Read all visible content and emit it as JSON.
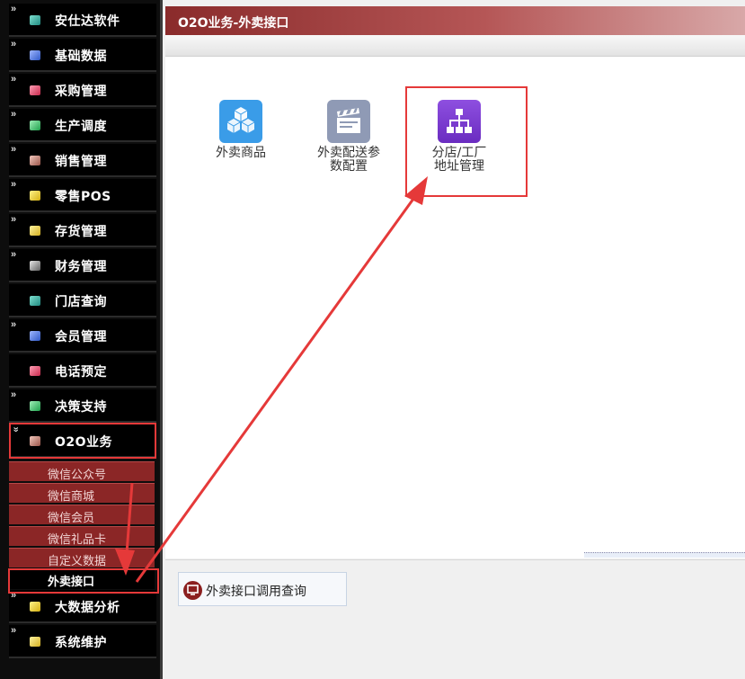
{
  "sidebar": {
    "items": [
      {
        "label": "安仕达软件",
        "icon": "module-icon",
        "color": "#3aa89a"
      },
      {
        "label": "基础数据",
        "icon": "module-icon",
        "color": "#4b77e0"
      },
      {
        "label": "采购管理",
        "icon": "module-icon",
        "color": "#e0486a"
      },
      {
        "label": "生产调度",
        "icon": "module-icon",
        "color": "#3dc56b"
      },
      {
        "label": "销售管理",
        "icon": "module-icon",
        "color": "#c98478"
      },
      {
        "label": "零售POS",
        "icon": "module-icon",
        "color": "#f0d230"
      },
      {
        "label": "存货管理",
        "icon": "module-icon",
        "color": "#f0d53a"
      },
      {
        "label": "财务管理",
        "icon": "module-icon",
        "color": "#9a9a9a"
      },
      {
        "label": "门店查询",
        "icon": "module-icon",
        "color": "#2fa6a0"
      },
      {
        "label": "会员管理",
        "icon": "module-icon",
        "color": "#3f6fd8"
      },
      {
        "label": "电话预定",
        "icon": "module-icon",
        "color": "#e44a6e"
      },
      {
        "label": "决策支持",
        "icon": "module-icon",
        "color": "#44c86e"
      },
      {
        "label": "O2O业务",
        "icon": "module-icon",
        "color": "#c98478"
      }
    ],
    "sub_items": [
      {
        "label": "微信公众号"
      },
      {
        "label": "微信商城"
      },
      {
        "label": "微信会员"
      },
      {
        "label": "微信礼品卡"
      },
      {
        "label": "自定义数据"
      },
      {
        "label": "外卖接口"
      }
    ],
    "items_after": [
      {
        "label": "大数据分析",
        "icon": "module-icon",
        "color": "#f0d230"
      },
      {
        "label": "系统维护",
        "icon": "module-icon",
        "color": "#f0d53a"
      }
    ]
  },
  "header": {
    "title": "O2O业务-外卖接口"
  },
  "apps": [
    {
      "label_line1": "外卖商品",
      "label_line2": "",
      "icon": "cubes-icon",
      "color": "#3a9ce8"
    },
    {
      "label_line1": "外卖配送参",
      "label_line2": "数配置",
      "icon": "clapperboard-icon",
      "color": "#8f9ab5"
    },
    {
      "label_line1": "分店/工厂",
      "label_line2": "地址管理",
      "icon": "org-chart-icon",
      "color": "#7a3bd0"
    }
  ],
  "bottom": {
    "query_label": "外卖接口调用查询",
    "query_icon": "monitor-icon"
  },
  "colors": {
    "accent": "#8a2b2b",
    "highlight": "#e53939"
  }
}
